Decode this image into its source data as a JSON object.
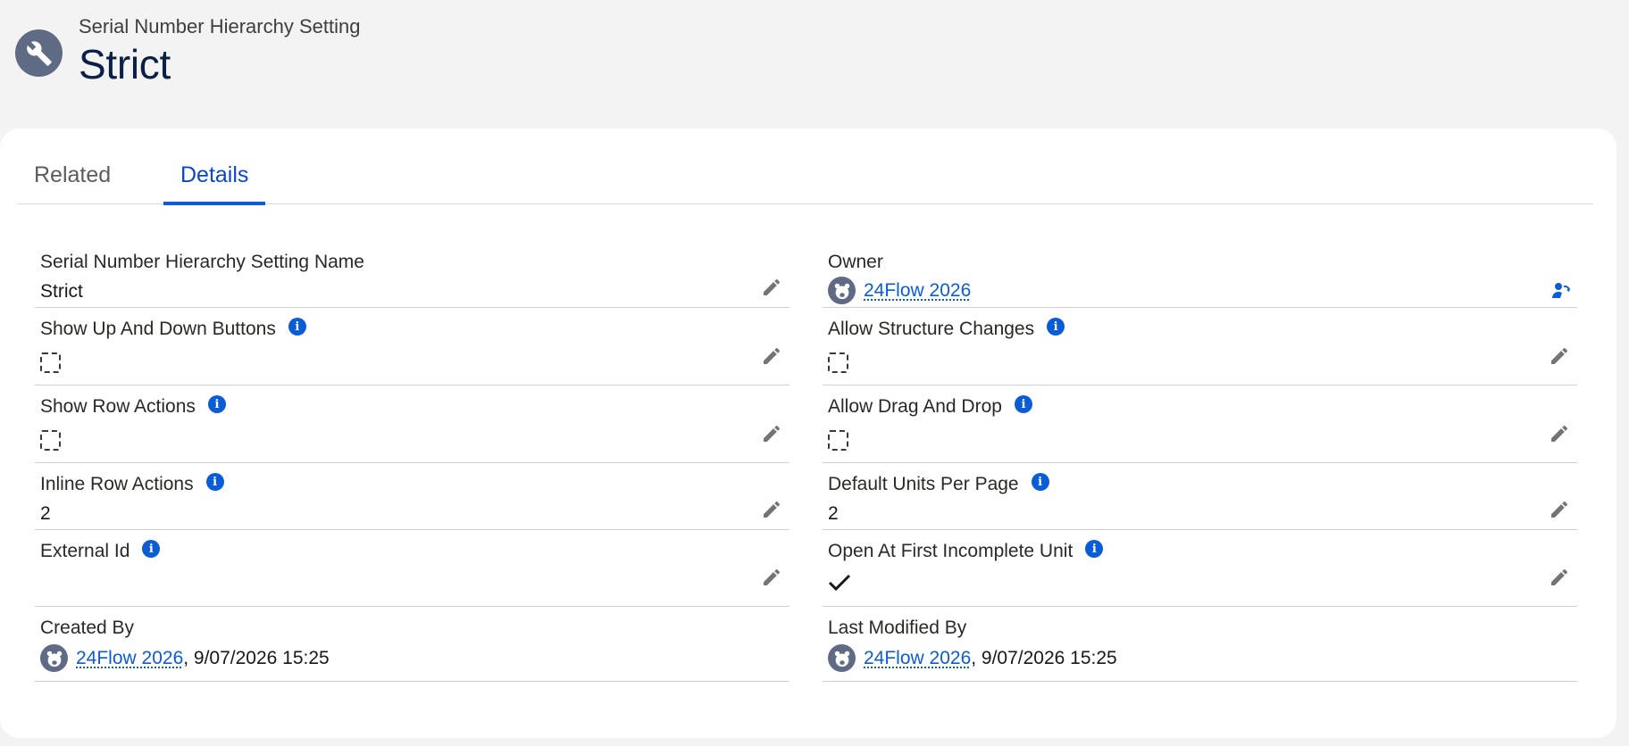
{
  "header": {
    "subtitle": "Serial Number Hierarchy Setting",
    "title": "Strict",
    "icon": "wrench-icon"
  },
  "tabs": [
    {
      "label": "Related",
      "active": false
    },
    {
      "label": "Details",
      "active": true
    }
  ],
  "left_fields": {
    "name_label": "Serial Number Hierarchy Setting Name",
    "name_value": "Strict",
    "show_up_down_label": "Show Up And Down Buttons",
    "show_up_down_checked": false,
    "show_row_actions_label": "Show Row Actions",
    "show_row_actions_checked": false,
    "inline_row_actions_label": "Inline Row Actions",
    "inline_row_actions_value": "2",
    "external_id_label": "External Id",
    "external_id_value": "",
    "created_by_label": "Created By",
    "created_by_user": "24Flow 2026",
    "created_by_date": ", 9/07/2026 15:25"
  },
  "right_fields": {
    "owner_label": "Owner",
    "owner_user": "24Flow 2026",
    "allow_structure_label": "Allow Structure Changes",
    "allow_structure_checked": false,
    "allow_dnd_label": "Allow Drag And Drop",
    "allow_dnd_checked": false,
    "default_units_label": "Default Units Per Page",
    "default_units_value": "2",
    "open_first_label": "Open At First Incomplete Unit",
    "open_first_checked": true,
    "last_modified_label": "Last Modified By",
    "last_modified_user": "24Flow 2026",
    "last_modified_date": ", 9/07/2026 15:25"
  },
  "colors": {
    "accent": "#0b5cd7",
    "icon_bg": "#5f6a85",
    "title": "#0b2047"
  }
}
